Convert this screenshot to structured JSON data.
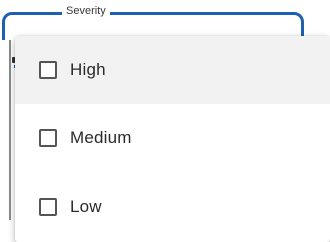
{
  "select": {
    "label": "Severity"
  },
  "menu": {
    "items": [
      {
        "label": "High",
        "checked": false,
        "hovered": true
      },
      {
        "label": "Medium",
        "checked": false,
        "hovered": false
      },
      {
        "label": "Low",
        "checked": false,
        "hovered": false
      }
    ]
  },
  "colors": {
    "outline_focus": "#1f5fb0",
    "hover_background": "#f2f2f2",
    "checkbox_border": "#555555",
    "text": "#2a2a2a"
  }
}
